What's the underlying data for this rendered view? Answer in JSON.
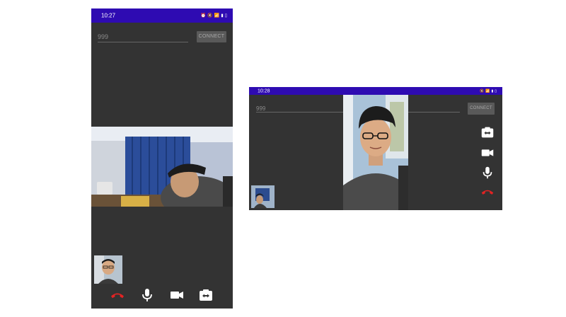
{
  "portrait": {
    "status_time": "10:27",
    "status_icons": [
      "alarm-icon",
      "mute-icon",
      "wifi-call-icon",
      "signal-icon",
      "battery-icon"
    ],
    "number_input": {
      "value": "999"
    },
    "connect_label": "CONNECT",
    "controls": [
      "end-call",
      "microphone",
      "camera",
      "switch-camera"
    ]
  },
  "landscape": {
    "status_time": "10:28",
    "status_icons": [
      "mute-icon",
      "wifi-call-icon",
      "signal-icon",
      "battery-icon"
    ],
    "number_input": {
      "value": "999"
    },
    "connect_label": "CONNECT",
    "controls": [
      "switch-camera",
      "camera",
      "microphone",
      "end-call"
    ]
  },
  "colors": {
    "status_bar": "#2e0bb2",
    "background": "#333333",
    "end_call": "#e32323",
    "icon": "#ffffff",
    "connect_button": "#595959"
  }
}
